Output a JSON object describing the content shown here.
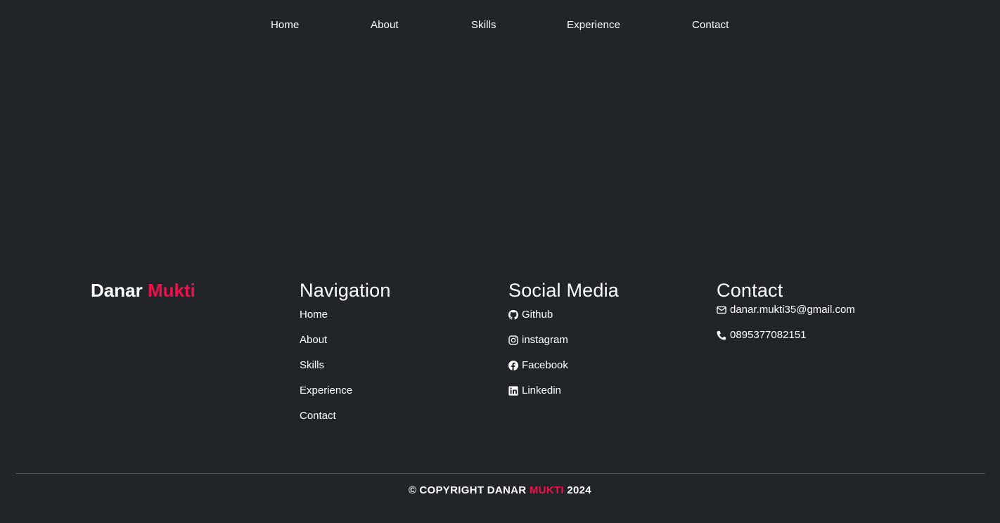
{
  "topnav": {
    "items": [
      {
        "label": "Home"
      },
      {
        "label": "About"
      },
      {
        "label": "Skills"
      },
      {
        "label": "Experience"
      },
      {
        "label": "Contact"
      }
    ]
  },
  "footer": {
    "brand": {
      "first": "Danar",
      "second": "Mukti"
    },
    "navigation": {
      "title": "Navigation",
      "items": [
        {
          "label": "Home"
        },
        {
          "label": "About"
        },
        {
          "label": "Skills"
        },
        {
          "label": "Experience"
        },
        {
          "label": "Contact"
        }
      ]
    },
    "social": {
      "title": "Social Media",
      "items": [
        {
          "label": "Github",
          "icon": "github-icon"
        },
        {
          "label": "instagram",
          "icon": "instagram-icon"
        },
        {
          "label": "Facebook",
          "icon": "facebook-icon"
        },
        {
          "label": "Linkedin",
          "icon": "linkedin-icon"
        }
      ]
    },
    "contact": {
      "title": "Contact",
      "email": "danar.mukti35@gmail.com",
      "phone": "0895377082151"
    },
    "copyright": {
      "symbol": "©",
      "prefix": "COPYRIGHT DANAR",
      "accent": "MUKTI",
      "year": "2024"
    }
  },
  "colors": {
    "background": "#212429",
    "accent": "#f0104a",
    "text": "#ffffff",
    "divider": "#565a60"
  }
}
